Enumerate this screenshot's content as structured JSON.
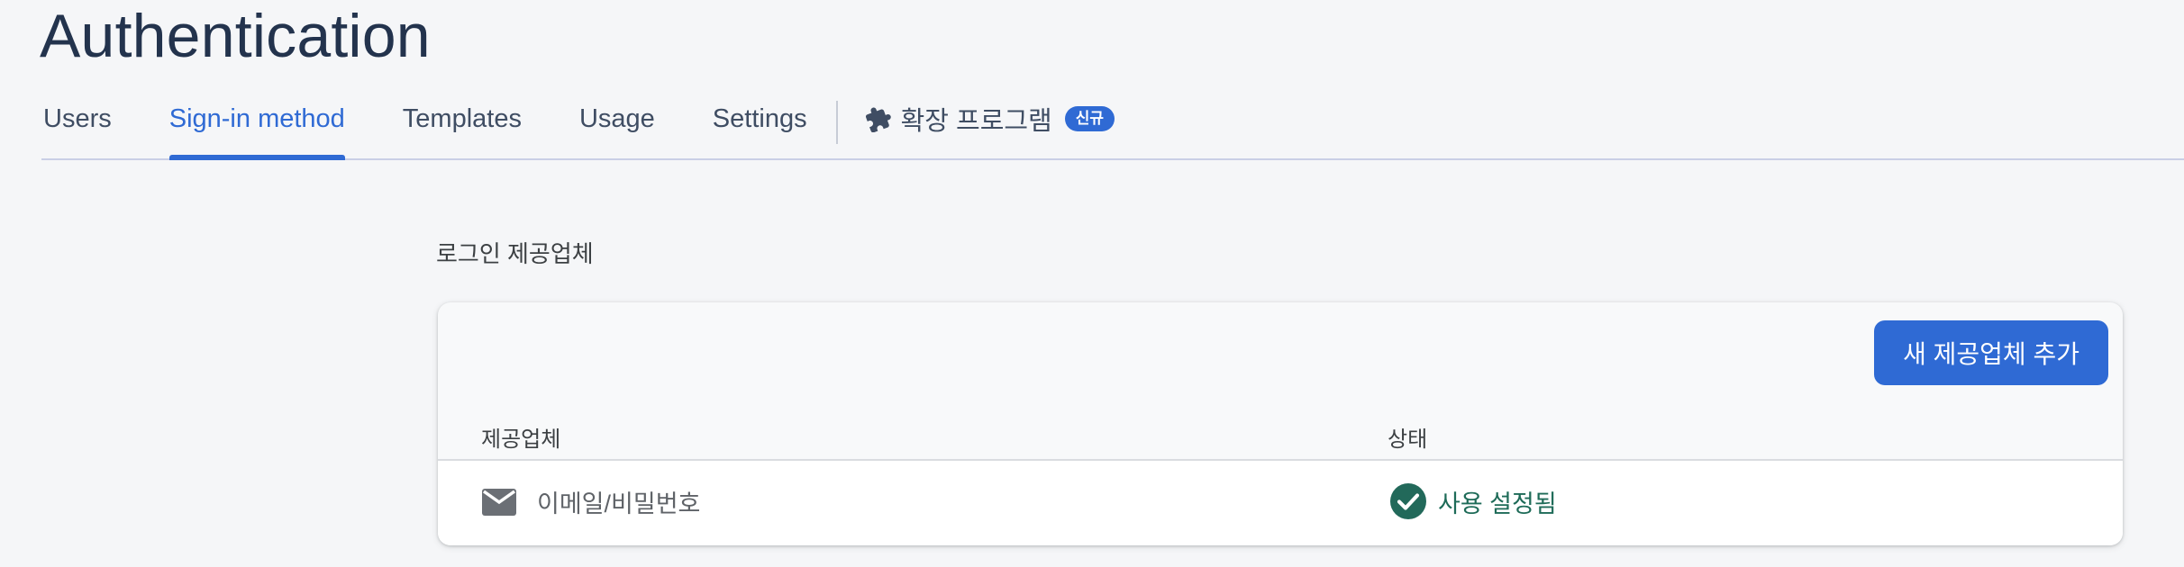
{
  "header": {
    "title": "Authentication"
  },
  "tabs": [
    {
      "label": "Users",
      "active": false
    },
    {
      "label": "Sign-in method",
      "active": true
    },
    {
      "label": "Templates",
      "active": false
    },
    {
      "label": "Usage",
      "active": false
    },
    {
      "label": "Settings",
      "active": false
    }
  ],
  "extensions_tab": {
    "icon": "puzzle-piece-icon",
    "label": "확장 프로그램",
    "badge": "신규"
  },
  "providers_section": {
    "title": "로그인 제공업체",
    "add_button_label": "새 제공업체 추가",
    "columns": {
      "provider": "제공업체",
      "status": "상태"
    },
    "rows": [
      {
        "icon": "mail-icon",
        "provider": "이메일/비밀번호",
        "status_icon": "check-circle-icon",
        "status": "사용 설정됨"
      }
    ]
  },
  "colors": {
    "accent": "#2f6ad4",
    "title": "#23334d",
    "status_enabled": "#1e6b58",
    "background": "#f5f6f8"
  }
}
